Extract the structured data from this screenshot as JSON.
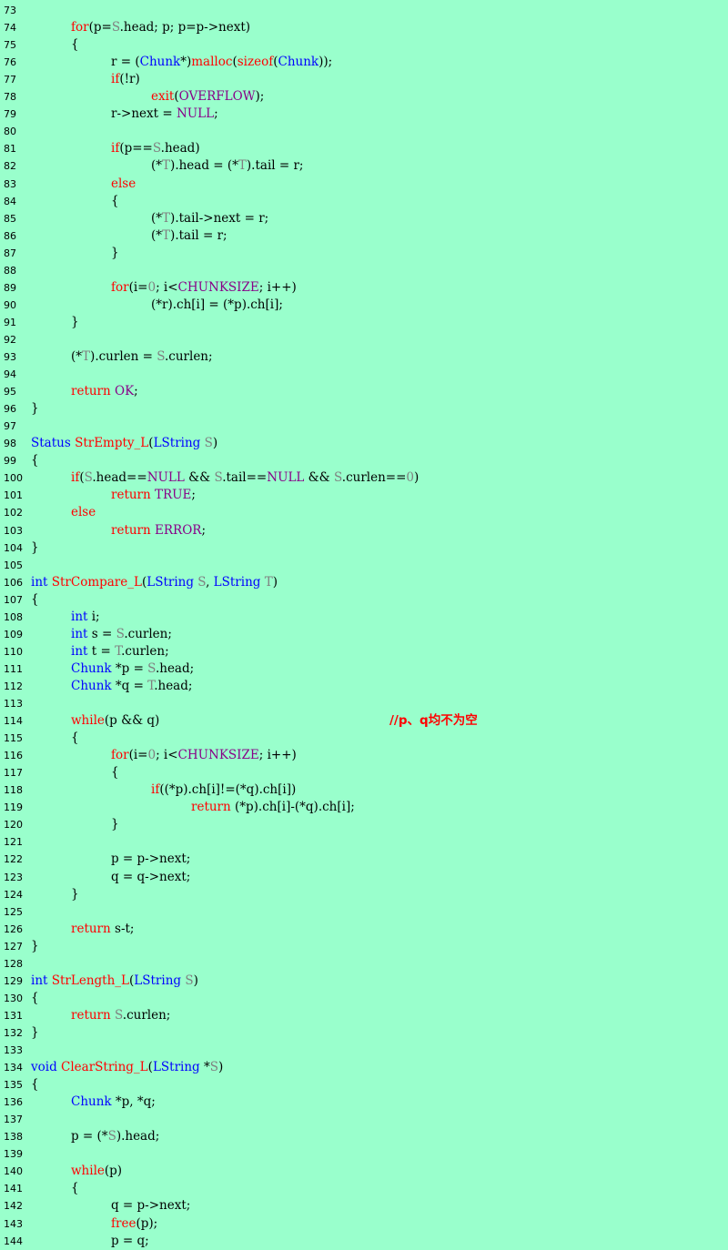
{
  "colors": {
    "background": "#99ffcc",
    "plain": "#000000",
    "keyword": "#ff0000",
    "type": "#0000ff",
    "macro": "#880088",
    "gray": "#808080",
    "comment": "#ff0000"
  },
  "lines": [
    {
      "n": "73",
      "indent": 0,
      "tokens": []
    },
    {
      "n": "74",
      "indent": 1,
      "tokens": [
        [
          "for",
          "k"
        ],
        [
          "(p=",
          ""
        ],
        [
          "S",
          "g"
        ],
        [
          ".head; p; p=p->next)",
          ""
        ]
      ]
    },
    {
      "n": "75",
      "indent": 1,
      "tokens": [
        [
          "{",
          ""
        ]
      ]
    },
    {
      "n": "76",
      "indent": 2,
      "tokens": [
        [
          "r = (",
          ""
        ],
        [
          "Chunk",
          "t"
        ],
        [
          "*)",
          ""
        ],
        [
          "malloc",
          "k"
        ],
        [
          "(",
          ""
        ],
        [
          "sizeof",
          "k"
        ],
        [
          "(",
          ""
        ],
        [
          "Chunk",
          "t"
        ],
        [
          "));",
          ""
        ]
      ]
    },
    {
      "n": "77",
      "indent": 2,
      "tokens": [
        [
          "if",
          "k"
        ],
        [
          "(!r)",
          ""
        ]
      ]
    },
    {
      "n": "78",
      "indent": 3,
      "tokens": [
        [
          "exit",
          "k"
        ],
        [
          "(",
          ""
        ],
        [
          "OVERFLOW",
          "m"
        ],
        [
          ");",
          ""
        ]
      ]
    },
    {
      "n": "79",
      "indent": 2,
      "tokens": [
        [
          "r->next = ",
          ""
        ],
        [
          "NULL",
          "m"
        ],
        [
          ";",
          ""
        ]
      ]
    },
    {
      "n": "80",
      "indent": 0,
      "tokens": []
    },
    {
      "n": "81",
      "indent": 2,
      "tokens": [
        [
          "if",
          "k"
        ],
        [
          "(p==",
          ""
        ],
        [
          "S",
          "g"
        ],
        [
          ".head)",
          ""
        ]
      ]
    },
    {
      "n": "82",
      "indent": 3,
      "tokens": [
        [
          "(*",
          ""
        ],
        [
          "T",
          "g"
        ],
        [
          ").head = (*",
          ""
        ],
        [
          "T",
          "g"
        ],
        [
          ").tail = r;",
          ""
        ]
      ]
    },
    {
      "n": "83",
      "indent": 2,
      "tokens": [
        [
          "else",
          "k"
        ]
      ]
    },
    {
      "n": "84",
      "indent": 2,
      "tokens": [
        [
          "{",
          ""
        ]
      ]
    },
    {
      "n": "85",
      "indent": 3,
      "tokens": [
        [
          "(*",
          ""
        ],
        [
          "T",
          "g"
        ],
        [
          ").tail->next = r;",
          ""
        ]
      ]
    },
    {
      "n": "86",
      "indent": 3,
      "tokens": [
        [
          "(*",
          ""
        ],
        [
          "T",
          "g"
        ],
        [
          ").tail = r;",
          ""
        ]
      ]
    },
    {
      "n": "87",
      "indent": 2,
      "tokens": [
        [
          "}",
          ""
        ]
      ]
    },
    {
      "n": "88",
      "indent": 0,
      "tokens": []
    },
    {
      "n": "89",
      "indent": 2,
      "tokens": [
        [
          "for",
          "k"
        ],
        [
          "(i=",
          ""
        ],
        [
          "0",
          "g"
        ],
        [
          "; i<",
          ""
        ],
        [
          "CHUNKSIZE",
          "m"
        ],
        [
          "; i++)",
          ""
        ]
      ]
    },
    {
      "n": "90",
      "indent": 3,
      "tokens": [
        [
          "(*r).ch[i] = (*p).ch[i];",
          ""
        ]
      ]
    },
    {
      "n": "91",
      "indent": 1,
      "tokens": [
        [
          "}",
          ""
        ]
      ]
    },
    {
      "n": "92",
      "indent": 0,
      "tokens": []
    },
    {
      "n": "93",
      "indent": 1,
      "tokens": [
        [
          "(*",
          ""
        ],
        [
          "T",
          "g"
        ],
        [
          ").curlen = ",
          ""
        ],
        [
          "S",
          "g"
        ],
        [
          ".curlen;",
          ""
        ]
      ]
    },
    {
      "n": "94",
      "indent": 0,
      "tokens": []
    },
    {
      "n": "95",
      "indent": 1,
      "tokens": [
        [
          "return",
          "k"
        ],
        [
          " ",
          ""
        ],
        [
          "OK",
          "m"
        ],
        [
          ";",
          ""
        ]
      ]
    },
    {
      "n": "96",
      "indent": 0,
      "tokens": [
        [
          "}",
          ""
        ]
      ]
    },
    {
      "n": "97",
      "indent": 0,
      "tokens": []
    },
    {
      "n": "98",
      "indent": 0,
      "tokens": [
        [
          "Status",
          "t"
        ],
        [
          " ",
          ""
        ],
        [
          "StrEmpty_L",
          "k"
        ],
        [
          "(",
          ""
        ],
        [
          "LString",
          "t"
        ],
        [
          " ",
          ""
        ],
        [
          "S",
          "g"
        ],
        [
          ")",
          ""
        ]
      ]
    },
    {
      "n": "99",
      "indent": 0,
      "tokens": [
        [
          "{",
          ""
        ]
      ]
    },
    {
      "n": "100",
      "indent": 1,
      "tokens": [
        [
          "if",
          "k"
        ],
        [
          "(",
          ""
        ],
        [
          "S",
          "g"
        ],
        [
          ".head==",
          ""
        ],
        [
          "NULL",
          "m"
        ],
        [
          " && ",
          ""
        ],
        [
          "S",
          "g"
        ],
        [
          ".tail==",
          ""
        ],
        [
          "NULL",
          "m"
        ],
        [
          " && ",
          ""
        ],
        [
          "S",
          "g"
        ],
        [
          ".curlen==",
          ""
        ],
        [
          "0",
          "g"
        ],
        [
          ")",
          ""
        ]
      ]
    },
    {
      "n": "101",
      "indent": 2,
      "tokens": [
        [
          "return",
          "k"
        ],
        [
          " ",
          ""
        ],
        [
          "TRUE",
          "m"
        ],
        [
          ";",
          ""
        ]
      ]
    },
    {
      "n": "102",
      "indent": 1,
      "tokens": [
        [
          "else",
          "k"
        ]
      ]
    },
    {
      "n": "103",
      "indent": 2,
      "tokens": [
        [
          "return",
          "k"
        ],
        [
          " ",
          ""
        ],
        [
          "ERROR",
          "m"
        ],
        [
          ";",
          ""
        ]
      ]
    },
    {
      "n": "104",
      "indent": 0,
      "tokens": [
        [
          "}",
          ""
        ]
      ]
    },
    {
      "n": "105",
      "indent": 0,
      "tokens": []
    },
    {
      "n": "106",
      "indent": 0,
      "tokens": [
        [
          "int",
          "t"
        ],
        [
          " ",
          ""
        ],
        [
          "StrCompare_L",
          "k"
        ],
        [
          "(",
          ""
        ],
        [
          "LString",
          "t"
        ],
        [
          " ",
          ""
        ],
        [
          "S",
          "g"
        ],
        [
          ", ",
          ""
        ],
        [
          "LString",
          "t"
        ],
        [
          " ",
          ""
        ],
        [
          "T",
          "g"
        ],
        [
          ")",
          ""
        ]
      ]
    },
    {
      "n": "107",
      "indent": 0,
      "tokens": [
        [
          "{",
          ""
        ]
      ]
    },
    {
      "n": "108",
      "indent": 1,
      "tokens": [
        [
          "int",
          "t"
        ],
        [
          " i;",
          ""
        ]
      ]
    },
    {
      "n": "109",
      "indent": 1,
      "tokens": [
        [
          "int",
          "t"
        ],
        [
          " s = ",
          ""
        ],
        [
          "S",
          "g"
        ],
        [
          ".curlen;",
          ""
        ]
      ]
    },
    {
      "n": "110",
      "indent": 1,
      "tokens": [
        [
          "int",
          "t"
        ],
        [
          " t = ",
          ""
        ],
        [
          "T",
          "g"
        ],
        [
          ".curlen;",
          ""
        ]
      ]
    },
    {
      "n": "111",
      "indent": 1,
      "tokens": [
        [
          "Chunk",
          "t"
        ],
        [
          " *p = ",
          ""
        ],
        [
          "S",
          "g"
        ],
        [
          ".head;",
          ""
        ]
      ]
    },
    {
      "n": "112",
      "indent": 1,
      "tokens": [
        [
          "Chunk",
          "t"
        ],
        [
          " *q = ",
          ""
        ],
        [
          "T",
          "g"
        ],
        [
          ".head;",
          ""
        ]
      ]
    },
    {
      "n": "113",
      "indent": 0,
      "tokens": []
    },
    {
      "n": "114",
      "indent": 1,
      "tokens": [
        [
          "while",
          "k"
        ],
        [
          "(p && q)",
          ""
        ]
      ],
      "comment": "//p、q均不为空"
    },
    {
      "n": "115",
      "indent": 1,
      "tokens": [
        [
          "{",
          ""
        ]
      ]
    },
    {
      "n": "116",
      "indent": 2,
      "tokens": [
        [
          "for",
          "k"
        ],
        [
          "(i=",
          ""
        ],
        [
          "0",
          "g"
        ],
        [
          "; i<",
          ""
        ],
        [
          "CHUNKSIZE",
          "m"
        ],
        [
          "; i++)",
          ""
        ]
      ]
    },
    {
      "n": "117",
      "indent": 2,
      "tokens": [
        [
          "{",
          ""
        ]
      ]
    },
    {
      "n": "118",
      "indent": 3,
      "tokens": [
        [
          "if",
          "k"
        ],
        [
          "((*p).ch[i]!=(*q).ch[i])",
          ""
        ]
      ]
    },
    {
      "n": "119",
      "indent": 4,
      "tokens": [
        [
          "return",
          "k"
        ],
        [
          " (*p).ch[i]-(*q).ch[i];",
          ""
        ]
      ]
    },
    {
      "n": "120",
      "indent": 2,
      "tokens": [
        [
          "}",
          ""
        ]
      ]
    },
    {
      "n": "121",
      "indent": 0,
      "tokens": []
    },
    {
      "n": "122",
      "indent": 2,
      "tokens": [
        [
          "p = p->next;",
          ""
        ]
      ]
    },
    {
      "n": "123",
      "indent": 2,
      "tokens": [
        [
          "q = q->next;",
          ""
        ]
      ]
    },
    {
      "n": "124",
      "indent": 1,
      "tokens": [
        [
          "}",
          ""
        ]
      ]
    },
    {
      "n": "125",
      "indent": 0,
      "tokens": []
    },
    {
      "n": "126",
      "indent": 1,
      "tokens": [
        [
          "return",
          "k"
        ],
        [
          " s-t;",
          ""
        ]
      ]
    },
    {
      "n": "127",
      "indent": 0,
      "tokens": [
        [
          "}",
          ""
        ]
      ]
    },
    {
      "n": "128",
      "indent": 0,
      "tokens": []
    },
    {
      "n": "129",
      "indent": 0,
      "tokens": [
        [
          "int",
          "t"
        ],
        [
          " ",
          ""
        ],
        [
          "StrLength_L",
          "k"
        ],
        [
          "(",
          ""
        ],
        [
          "LString",
          "t"
        ],
        [
          " ",
          ""
        ],
        [
          "S",
          "g"
        ],
        [
          ")",
          ""
        ]
      ]
    },
    {
      "n": "130",
      "indent": 0,
      "tokens": [
        [
          "{",
          ""
        ]
      ]
    },
    {
      "n": "131",
      "indent": 1,
      "tokens": [
        [
          "return",
          "k"
        ],
        [
          " ",
          ""
        ],
        [
          "S",
          "g"
        ],
        [
          ".curlen;",
          ""
        ]
      ]
    },
    {
      "n": "132",
      "indent": 0,
      "tokens": [
        [
          "}",
          ""
        ]
      ]
    },
    {
      "n": "133",
      "indent": 0,
      "tokens": []
    },
    {
      "n": "134",
      "indent": 0,
      "tokens": [
        [
          "void",
          "t"
        ],
        [
          " ",
          ""
        ],
        [
          "ClearString_L",
          "k"
        ],
        [
          "(",
          ""
        ],
        [
          "LString",
          "t"
        ],
        [
          " *",
          ""
        ],
        [
          "S",
          "g"
        ],
        [
          ")",
          ""
        ]
      ]
    },
    {
      "n": "135",
      "indent": 0,
      "tokens": [
        [
          "{",
          ""
        ]
      ]
    },
    {
      "n": "136",
      "indent": 1,
      "tokens": [
        [
          "Chunk",
          "t"
        ],
        [
          " *p, *q;",
          ""
        ]
      ]
    },
    {
      "n": "137",
      "indent": 0,
      "tokens": []
    },
    {
      "n": "138",
      "indent": 1,
      "tokens": [
        [
          "p = (*",
          ""
        ],
        [
          "S",
          "g"
        ],
        [
          ").head;",
          ""
        ]
      ]
    },
    {
      "n": "139",
      "indent": 0,
      "tokens": []
    },
    {
      "n": "140",
      "indent": 1,
      "tokens": [
        [
          "while",
          "k"
        ],
        [
          "(p)",
          ""
        ]
      ]
    },
    {
      "n": "141",
      "indent": 1,
      "tokens": [
        [
          "{",
          ""
        ]
      ]
    },
    {
      "n": "142",
      "indent": 2,
      "tokens": [
        [
          "q = p->next;",
          ""
        ]
      ]
    },
    {
      "n": "143",
      "indent": 2,
      "tokens": [
        [
          "free",
          "k"
        ],
        [
          "(p);",
          ""
        ]
      ]
    },
    {
      "n": "144",
      "indent": 2,
      "tokens": [
        [
          "p = q;",
          ""
        ]
      ]
    }
  ]
}
